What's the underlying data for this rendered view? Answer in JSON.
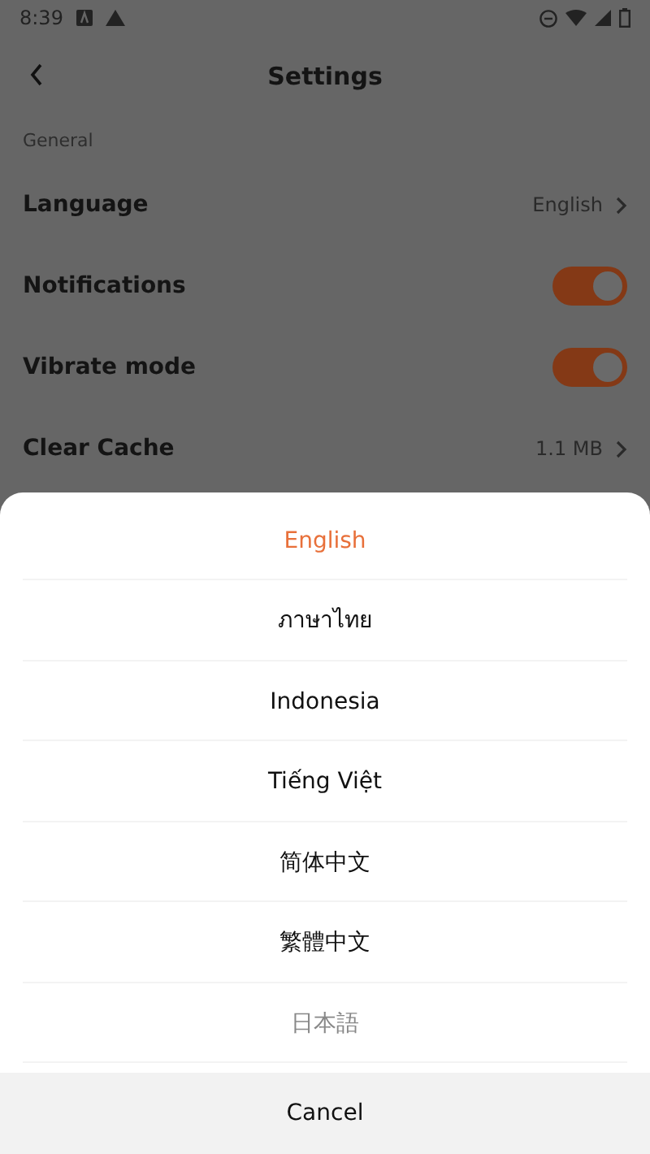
{
  "status_bar": {
    "time": "8:39"
  },
  "header": {
    "title": "Settings"
  },
  "section": {
    "title": "General"
  },
  "settings": [
    {
      "kind": "link",
      "label": "Language",
      "value": "English"
    },
    {
      "kind": "toggle",
      "label": "Notifications",
      "on": true
    },
    {
      "kind": "toggle",
      "label": "Vibrate mode",
      "on": true
    },
    {
      "kind": "link",
      "label": "Clear Cache",
      "value": "1.1 MB"
    }
  ],
  "language_sheet": {
    "options": [
      {
        "label": "English",
        "selected": true,
        "disabled": false
      },
      {
        "label": "ภาษาไทย",
        "selected": false,
        "disabled": false
      },
      {
        "label": "Indonesia",
        "selected": false,
        "disabled": false
      },
      {
        "label": "Tiếng Việt",
        "selected": false,
        "disabled": false
      },
      {
        "label": "简体中文",
        "selected": false,
        "disabled": false
      },
      {
        "label": "繁體中文",
        "selected": false,
        "disabled": false
      },
      {
        "label": "日本語",
        "selected": false,
        "disabled": true
      }
    ],
    "cancel": "Cancel"
  }
}
